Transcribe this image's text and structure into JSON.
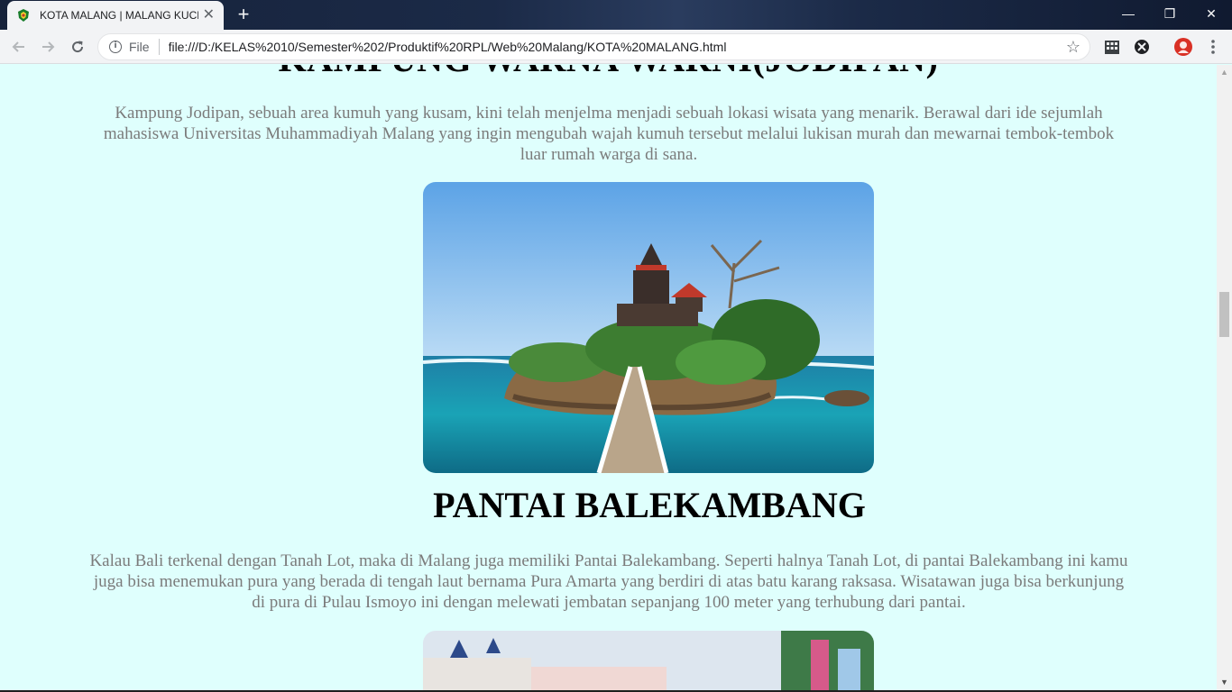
{
  "browser": {
    "tab_title": "KOTA MALANG | MALANG KUCECWARA",
    "tab_close": "✕",
    "new_tab": "+",
    "url_scheme_label": "File",
    "url": "file:///D:/KELAS%2010/Semester%202/Produktif%20RPL/Web%20Malang/KOTA%20MALANG.html",
    "window_controls": {
      "minimize": "—",
      "restore": "❐",
      "close": "✕"
    }
  },
  "page": {
    "section1_heading": "KAMPUNG WARNA WARNI(JODIPAN)",
    "section1_text": "Kampung Jodipan, sebuah area kumuh yang kusam, kini telah menjelma menjadi sebuah lokasi wisata yang menarik. Berawal dari ide sejumlah mahasiswa Universitas Muhammadiyah Malang yang ingin mengubah wajah kumuh tersebut melalui lukisan murah dan mewarnai tembok-tembok luar rumah warga di sana.",
    "section2_heading": "PANTAI BALEKAMBANG",
    "section2_text": "Kalau Bali terkenal dengan Tanah Lot, maka di Malang juga memiliki Pantai Balekambang. Seperti halnya Tanah Lot, di pantai Balekambang ini kamu juga bisa menemukan pura yang berada di tengah laut bernama Pura Amarta yang berdiri di atas batu karang raksasa. Wisatawan juga bisa berkunjung di pura di Pulau Ismoyo ini dengan melewati jembatan sepanjang 100 meter yang terhubung dari pantai."
  },
  "colors": {
    "page_background": "#dffffd",
    "paragraph_text": "#7b7b7b",
    "heading_text": "#000000"
  },
  "icons": {
    "favicon": "malang-emblem-icon",
    "back": "arrow-left-icon",
    "forward": "arrow-right-icon",
    "reload": "reload-icon",
    "info": "info-icon",
    "bookmark": "star-icon",
    "ext1": "building-extension-icon",
    "ext2": "x-extension-icon",
    "profile": "avatar-icon",
    "menu": "kebab-menu-icon"
  }
}
